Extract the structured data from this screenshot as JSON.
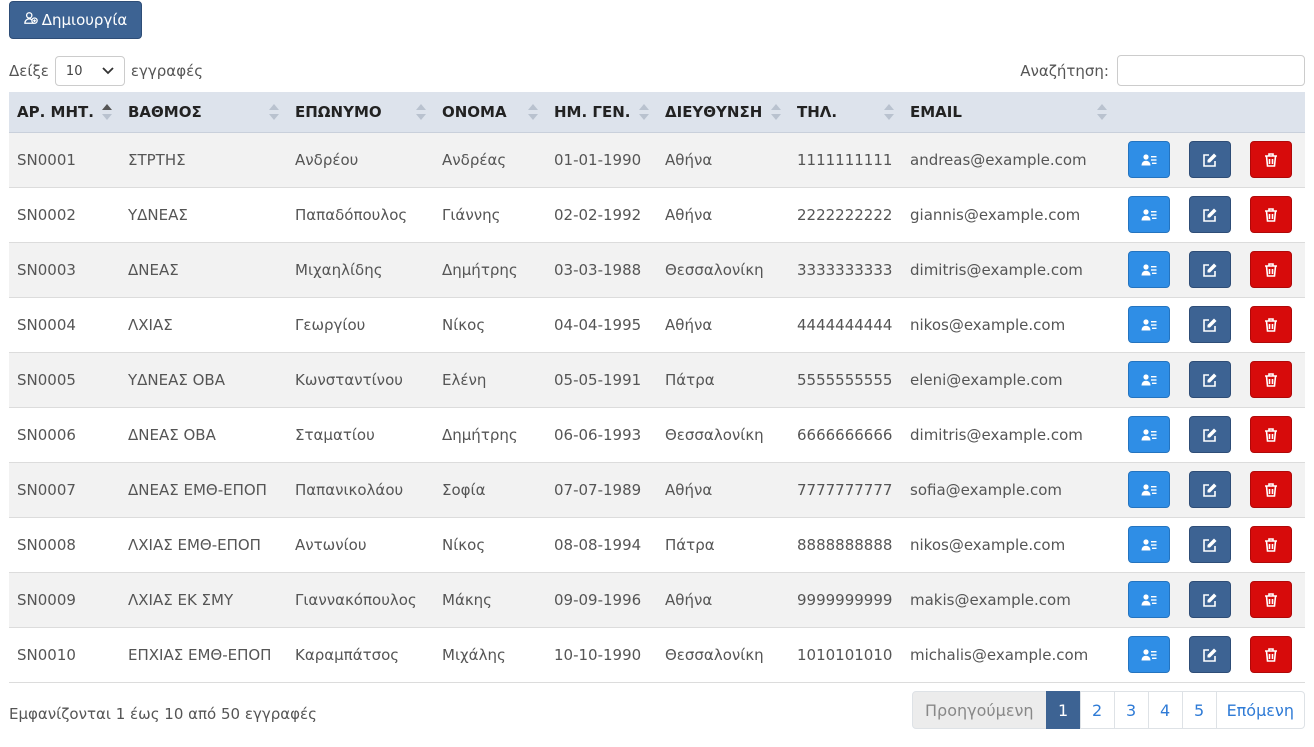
{
  "toolbar": {
    "create_label": "Δημιουργία"
  },
  "length": {
    "prefix": "Δείξε",
    "value": "10",
    "suffix": "εγγραφές"
  },
  "search": {
    "label": "Αναζήτηση:",
    "value": ""
  },
  "columns": [
    "ΑΡ. ΜΗΤ.",
    "ΒΑΘΜΟΣ",
    "ΕΠΩΝΥΜΟ",
    "ΟΝΟΜΑ",
    "ΗΜ. ΓΕΝ.",
    "ΔΙΕΥΘΥΝΣΗ",
    "ΤΗΛ.",
    "EMAIL"
  ],
  "sort": {
    "column": 0,
    "direction": "asc"
  },
  "rows": [
    [
      "SN0001",
      "ΣΤΡΤΗΣ",
      "Ανδρέου",
      "Ανδρέας",
      "01-01-1990",
      "Αθήνα",
      "1111111111",
      "andreas@example.com"
    ],
    [
      "SN0002",
      "ΥΔΝΕΑΣ",
      "Παπαδόπουλος",
      "Γιάννης",
      "02-02-1992",
      "Αθήνα",
      "2222222222",
      "giannis@example.com"
    ],
    [
      "SN0003",
      "ΔΝΕΑΣ",
      "Μιχαηλίδης",
      "Δημήτρης",
      "03-03-1988",
      "Θεσσαλονίκη",
      "3333333333",
      "dimitris@example.com"
    ],
    [
      "SN0004",
      "ΛΧΙΑΣ",
      "Γεωργίου",
      "Νίκος",
      "04-04-1995",
      "Αθήνα",
      "4444444444",
      "nikos@example.com"
    ],
    [
      "SN0005",
      "ΥΔΝΕΑΣ ΟΒΑ",
      "Κωνσταντίνου",
      "Ελένη",
      "05-05-1991",
      "Πάτρα",
      "5555555555",
      "eleni@example.com"
    ],
    [
      "SN0006",
      "ΔΝΕΑΣ ΟΒΑ",
      "Σταματίου",
      "Δημήτρης",
      "06-06-1993",
      "Θεσσαλονίκη",
      "6666666666",
      "dimitris@example.com"
    ],
    [
      "SN0007",
      "ΔΝΕΑΣ ΕΜΘ-ΕΠΟΠ",
      "Παπανικολάου",
      "Σοφία",
      "07-07-1989",
      "Αθήνα",
      "7777777777",
      "sofia@example.com"
    ],
    [
      "SN0008",
      "ΛΧΙΑΣ ΕΜΘ-ΕΠΟΠ",
      "Αντωνίου",
      "Νίκος",
      "08-08-1994",
      "Πάτρα",
      "8888888888",
      "nikos@example.com"
    ],
    [
      "SN0009",
      "ΛΧΙΑΣ ΕΚ ΣΜΥ",
      "Γιαννακόπουλος",
      "Μάκης",
      "09-09-1996",
      "Αθήνα",
      "9999999999",
      "makis@example.com"
    ],
    [
      "SN0010",
      "ΕΠΧΙΑΣ ΕΜΘ-ΕΠΟΠ",
      "Καραμπάτσος",
      "Μιχάλης",
      "10-10-1990",
      "Θεσσαλονίκη",
      "1010101010",
      "michalis@example.com"
    ]
  ],
  "row_actions": [
    "user-details-icon",
    "edit-icon",
    "trash-icon"
  ],
  "footer": {
    "info": "Εμφανίζονται 1 έως 10 από 50 εγγραφές",
    "prev_label": "Προηγούμενη",
    "pages": [
      "1",
      "2",
      "3",
      "4",
      "5"
    ],
    "active_page": "1",
    "next_label": "Επόμενη"
  },
  "colors": {
    "primary": "#3d6393",
    "view": "#2f8ee6",
    "delete": "#d70b0b",
    "header_bg": "#dde3ec",
    "link": "#2f7bd6"
  }
}
